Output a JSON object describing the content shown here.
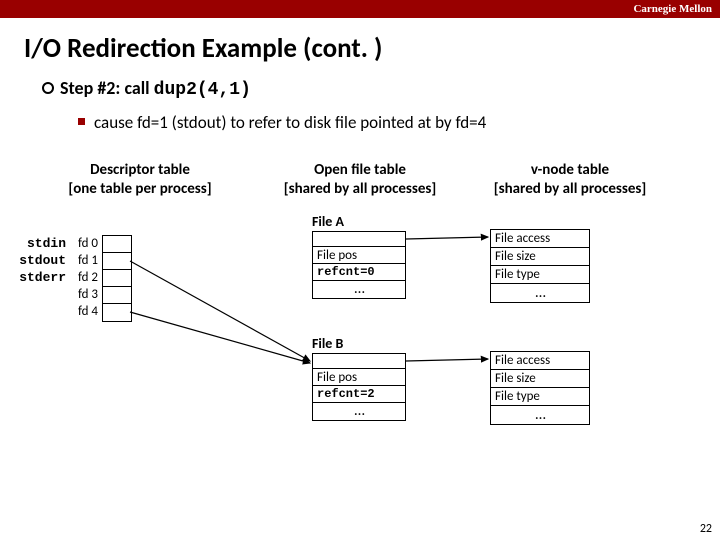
{
  "brand": "Carnegie Mellon",
  "title": "I/O Redirection Example (cont. )",
  "step_prefix": "Step #2: call ",
  "step_code": "dup2(4,1)",
  "subbullet": "cause fd=1 (stdout) to refer to disk file pointed at by fd=4",
  "headers": {
    "desc_t": "Descriptor table",
    "desc_s": "[one table per process]",
    "oft_t": "Open file table",
    "oft_s": "[shared by all processes]",
    "vnode_t": "v-node table",
    "vnode_s": "[shared by all processes]"
  },
  "std": {
    "in": "stdin",
    "out": "stdout",
    "err": "stderr"
  },
  "fd": {
    "0": "fd 0",
    "1": "fd 1",
    "2": "fd 2",
    "3": "fd 3",
    "4": "fd 4"
  },
  "fileA": {
    "label": "File A",
    "pos": "File pos",
    "ref": "refcnt=0"
  },
  "fileB": {
    "label": "File B",
    "pos": "File pos",
    "ref": "refcnt=2"
  },
  "vnode": {
    "access": "File access",
    "size": "File size",
    "type": "File type"
  },
  "ellipsis": "…",
  "pagenum": "22"
}
